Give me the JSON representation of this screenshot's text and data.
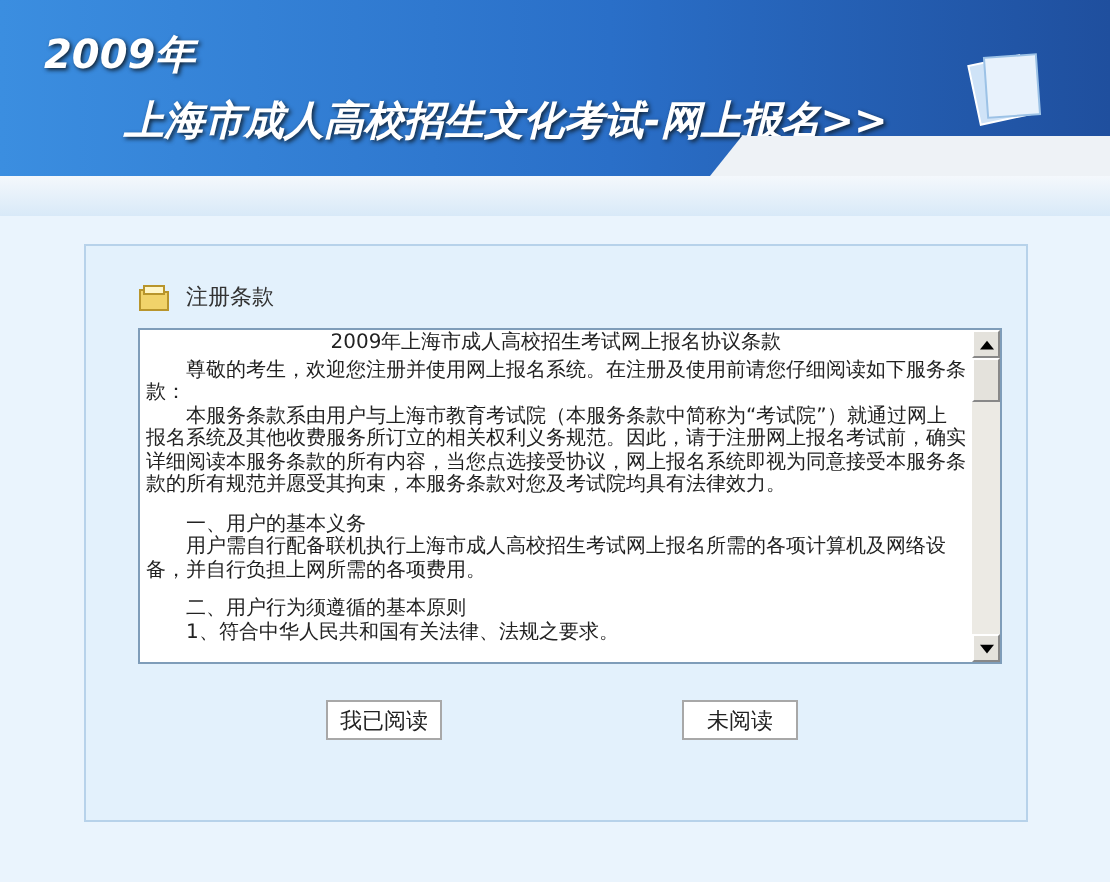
{
  "header": {
    "year": "2009年",
    "title": "上海市成人高校招生文化考试-网上报名>>"
  },
  "section": {
    "title": "注册条款"
  },
  "agreement": {
    "heading": "2009年上海市成人高校招生考试网上报名协议条款",
    "paragraphs": [
      {
        "kind": "para",
        "text": "尊敬的考生，欢迎您注册并使用网上报名系统。在注册及使用前请您仔细阅读如下服务条款："
      },
      {
        "kind": "para",
        "text": "本服务条款系由用户与上海市教育考试院（本服务条款中简称为“考试院”）就通过网上报名系统及其他收费服务所订立的相关权利义务规范。因此，请于注册网上报名考试前，确实详细阅读本服务条款的所有内容，当您点选接受协议，网上报名系统即视为同意接受本服务条款的所有规范并愿受其拘束，本服务条款对您及考试院均具有法律效力。"
      },
      {
        "kind": "gap"
      },
      {
        "kind": "para",
        "text": "一、用户的基本义务"
      },
      {
        "kind": "para",
        "text": "用户需自行配备联机执行上海市成人高校招生考试网上报名所需的各项计算机及网络设备，并自行负担上网所需的各项费用。"
      },
      {
        "kind": "gap"
      },
      {
        "kind": "para",
        "text": "二、用户行为须遵循的基本原则"
      },
      {
        "kind": "para",
        "text": "1、符合中华人民共和国有关法律、法规之要求。"
      }
    ]
  },
  "buttons": [
    "我已阅读",
    "未阅读"
  ]
}
